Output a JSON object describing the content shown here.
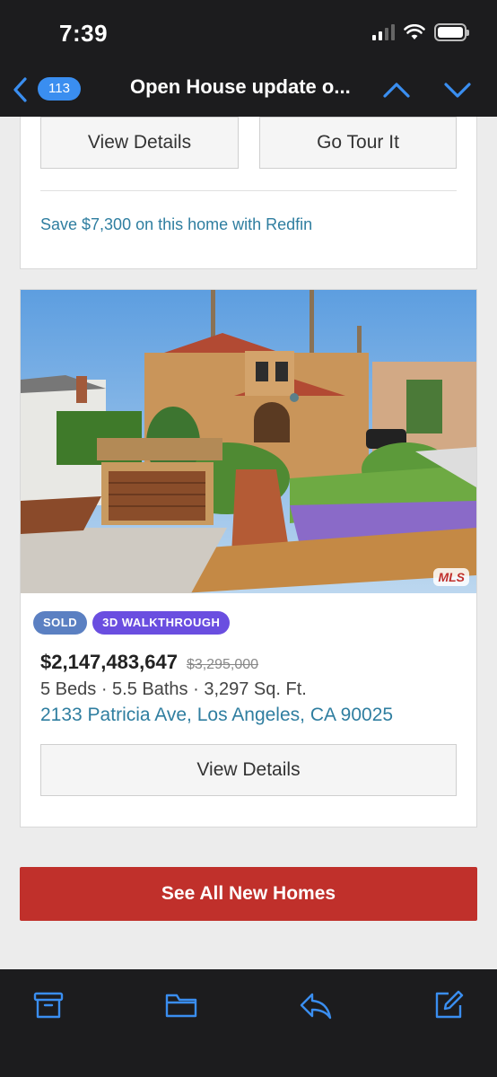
{
  "status": {
    "time": "7:39",
    "battery_level": 1.0
  },
  "nav": {
    "unread_count": "113",
    "title": "Open House update o..."
  },
  "card1": {
    "view_details_label": "View Details",
    "go_tour_label": "Go Tour It",
    "save_text": "Save $7,300 on this home with Redfin"
  },
  "listing": {
    "photo_watermark": "MLS",
    "tags": [
      "SOLD",
      "3D WALKTHROUGH"
    ],
    "price": "$2,147,483,647",
    "old_price": "$3,295,000",
    "specs": "5 Beds · 5.5 Baths · 3,297 Sq. Ft.",
    "address": "2133 Patricia Ave, Los Angeles, CA 90025",
    "view_details_label": "View Details"
  },
  "see_all_label": "See All New Homes",
  "toolbar": {
    "icons": [
      "archive-icon",
      "folder-icon",
      "reply-icon",
      "compose-icon"
    ]
  },
  "colors": {
    "link": "#2f7ea0",
    "cta": "#c0302b",
    "badge": "#3a8ef0",
    "nav_icon": "#3a8ef0"
  }
}
